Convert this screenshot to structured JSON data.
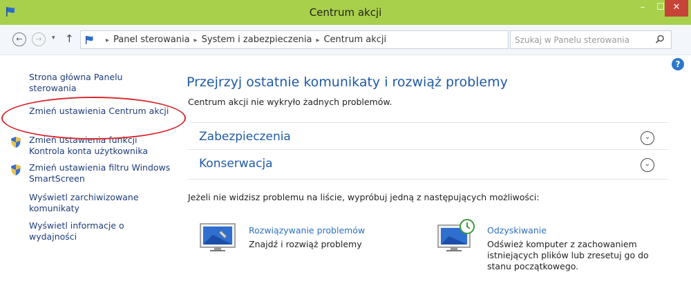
{
  "window": {
    "title": "Centrum akcji",
    "minimize_label": "–",
    "maximize_label": "☐",
    "close_label": "✕"
  },
  "address": {
    "back_label": "←",
    "forward_label": "→",
    "history_label": "▾",
    "up_label": "↑",
    "breadcrumbs": [
      "Panel sterowania",
      "System i zabezpieczenia",
      "Centrum akcji"
    ],
    "separator": "▸",
    "dropdown_label": "▾",
    "refresh_label": "↻",
    "search_placeholder": "Szukaj w Panelu sterowania"
  },
  "help_label": "?",
  "sidebar": {
    "items": [
      {
        "label": "Strona główna Panelu sterowania",
        "shield": false
      },
      {
        "label": "Zmień ustawienia Centrum akcji",
        "shield": false,
        "highlighted": true
      },
      {
        "label": "Zmień ustawienia funkcji Kontrola konta użytkownika",
        "shield": true
      },
      {
        "label": "Zmień ustawienia filtru Windows SmartScreen",
        "shield": true
      },
      {
        "label": "Wyświetl zarchiwizowane komunikaty",
        "shield": false
      },
      {
        "label": "Wyświetl informacje o wydajności",
        "shield": false
      }
    ]
  },
  "main": {
    "title": "Przejrzyj ostatnie komunikaty i rozwiąż problemy",
    "status": "Centrum akcji nie wykryło żadnych problemów.",
    "sections": [
      {
        "label": "Zabezpieczenia",
        "chevron": "⌄"
      },
      {
        "label": "Konserwacja",
        "chevron": "⌄"
      }
    ],
    "hint": "Jeżeli nie widzisz problemu na liście, wypróbuj jedną z następujących możliwości:",
    "options": [
      {
        "title": "Rozwiązywanie problemów",
        "description": "Znajdź i rozwiąż problemy",
        "icon": "troubleshooting-icon"
      },
      {
        "title": "Odzyskiwanie",
        "description": "Odśwież komputer z zachowaniem istniejących plików lub zresetuj go do stanu początkowego.",
        "icon": "recovery-icon"
      }
    ]
  },
  "colors": {
    "titlebar": "#a9d04a",
    "close_button": "#c74337",
    "link": "#1e5aa8",
    "highlight": "#d8262c"
  }
}
